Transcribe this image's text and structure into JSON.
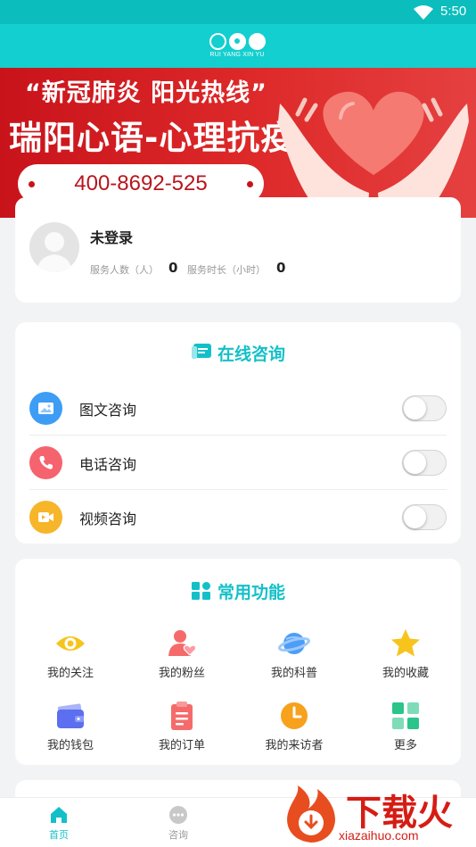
{
  "status_bar": {
    "time": "5:50",
    "wifi_icon": "wifi-icon"
  },
  "header": {
    "logo_text": "RUI YANG XIN YU"
  },
  "banner": {
    "slogan": "“新冠肺炎 阳光热线”",
    "headline": "瑞阳心语-心理抗疫",
    "hotline": "400-8692-525"
  },
  "user": {
    "name": "未登录",
    "served_label": "服务人数（人）",
    "served_value": "0",
    "duration_label": "服务时长（小时）",
    "duration_value": "0"
  },
  "consult": {
    "title": "在线咨询",
    "items": [
      {
        "label": "图文咨询",
        "icon": "image-icon",
        "color": "#3d9df5",
        "enabled": false
      },
      {
        "label": "电话咨询",
        "icon": "phone-icon",
        "color": "#f5636e",
        "enabled": false
      },
      {
        "label": "视频咨询",
        "icon": "video-icon",
        "color": "#f7b52a",
        "enabled": false
      }
    ]
  },
  "functions": {
    "title": "常用功能",
    "items": [
      {
        "label": "我的关注",
        "icon": "eye-icon"
      },
      {
        "label": "我的粉丝",
        "icon": "fans-icon"
      },
      {
        "label": "我的科普",
        "icon": "planet-icon"
      },
      {
        "label": "我的收藏",
        "icon": "star-icon"
      },
      {
        "label": "我的钱包",
        "icon": "wallet-icon"
      },
      {
        "label": "我的订单",
        "icon": "order-icon"
      },
      {
        "label": "我的来访者",
        "icon": "clock-icon"
      },
      {
        "label": "更多",
        "icon": "grid-icon"
      }
    ]
  },
  "tabbar": {
    "tabs": [
      {
        "label": "首页",
        "icon": "home-icon",
        "active": true
      },
      {
        "label": "咨询",
        "icon": "chat-icon",
        "active": false
      }
    ]
  },
  "watermark": {
    "text": "下载火",
    "url": "xiazaihuo.com"
  },
  "colors": {
    "accent": "#14c0c8",
    "header": "#13cfcf",
    "banner_red": "#c8131b"
  }
}
